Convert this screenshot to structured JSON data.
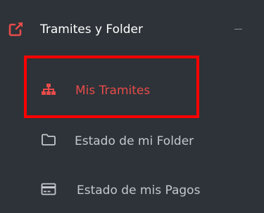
{
  "sidebar": {
    "section": {
      "label": "Tramites y Folder",
      "icon": "external-link-icon",
      "collapse_icon": "minus-icon"
    },
    "items": [
      {
        "label": "Mis Tramites",
        "icon": "sitemap-icon",
        "active": true
      },
      {
        "label": "Estado de mi Folder",
        "icon": "folder-icon",
        "active": false
      },
      {
        "label": "Estado de mis Pagos",
        "icon": "credit-card-icon",
        "active": false
      }
    ]
  },
  "colors": {
    "background": "#2d3338",
    "accent": "#e84b4b",
    "text": "#c4c8cc",
    "header_text": "#ffffff",
    "highlight_border": "#ff0000"
  }
}
